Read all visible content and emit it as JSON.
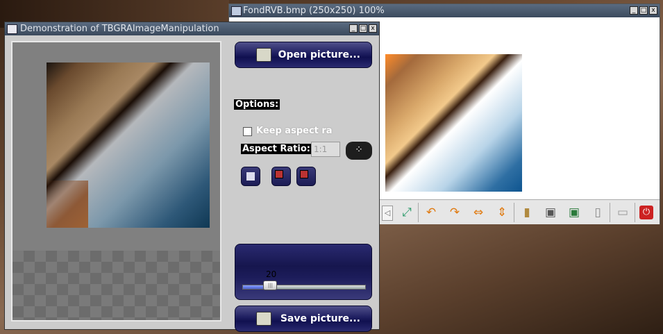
{
  "viewer": {
    "title": "FondRVB.bmp (250x250) 100%",
    "buttons": {
      "minimize": "_",
      "maximize": "□",
      "close": "x"
    },
    "toolbar": [
      "zoom-fit-icon",
      "rotate-left-icon",
      "rotate-right-icon",
      "flip-horizontal-icon",
      "flip-vertical-icon",
      "edit-icon",
      "save-icon",
      "save-as-icon",
      "delete-icon",
      "slideshow-icon",
      "exit-icon"
    ]
  },
  "demo": {
    "title": "Demonstration of TBGRAImageManipulation",
    "buttons": {
      "minimize": "_",
      "maximize": "□",
      "close": "x"
    },
    "open_label": "Open picture...",
    "options_label": "Options:",
    "keep_aspect_label": "Keep aspect ra",
    "keep_aspect_checked": false,
    "aspect_ratio_label": "Aspect Ratio:",
    "aspect_ratio_value": "1:1",
    "slider_value": "20",
    "slider_fraction": 0.23,
    "save_label": "Save picture..."
  }
}
